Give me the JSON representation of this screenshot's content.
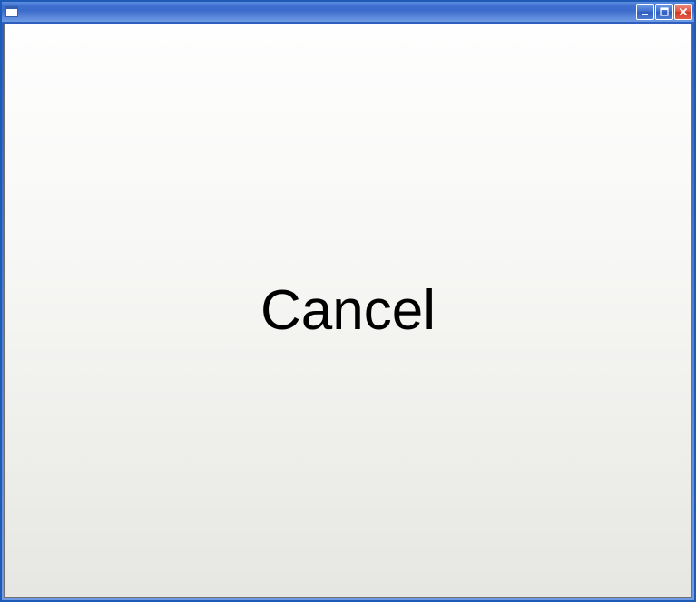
{
  "window": {
    "title": "",
    "controls": {
      "minimize": "Minimize",
      "maximize": "Maximize",
      "close": "Close"
    }
  },
  "client": {
    "button_label": "Cancel"
  }
}
